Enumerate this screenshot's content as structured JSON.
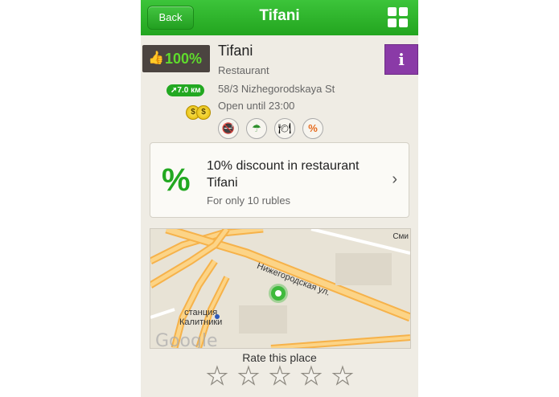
{
  "header": {
    "back_label": "Back",
    "title": "Tifani",
    "grid_icon": "grid-icon"
  },
  "place": {
    "rating_percent": "100%",
    "distance": "7.0 км",
    "price_level": "$$",
    "name": "Tifani",
    "type": "Restaurant",
    "address": "58/3 Nizhegorodskaya St",
    "hours": "Open until 23:00",
    "amenities": [
      "no-smoking-icon",
      "terrace-umbrella-icon",
      "business-lunch-icon",
      "discount-icon"
    ],
    "info_icon": "info-icon"
  },
  "offer": {
    "icon": "%",
    "title": "10% discount in restaurant Tifani",
    "subtitle": "For only 10 rubles"
  },
  "map": {
    "street_label": "Нижегородская ул.",
    "station_label_line1": "станция",
    "station_label_line2": "Калитники",
    "corner_label": "Сми",
    "attribution": "Google"
  },
  "rating": {
    "label": "Rate this place",
    "stars": 5,
    "selected": 0
  },
  "colors": {
    "header_green": "#2ab527",
    "accent_green": "#22a821",
    "info_purple": "#8a3aa7",
    "badge_dark": "#4b4440"
  }
}
